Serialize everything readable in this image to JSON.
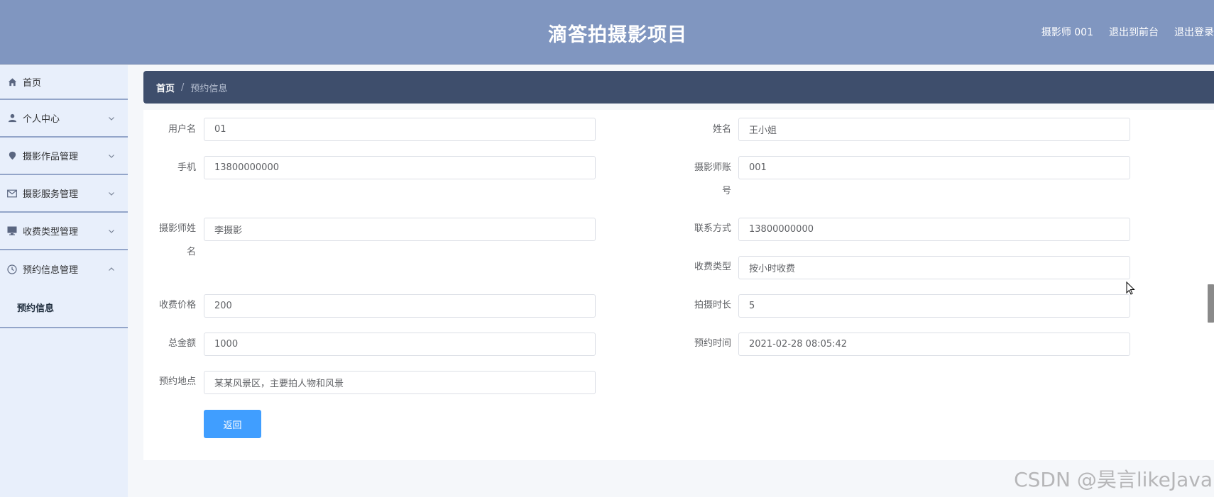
{
  "header": {
    "title": "滴答拍摄影项目",
    "user": "摄影师 001",
    "to_front": "退出到前台",
    "logout": "退出登录"
  },
  "sidebar": {
    "items": [
      {
        "label": "首页",
        "icon": "home-icon"
      },
      {
        "label": "个人中心",
        "icon": "user-icon"
      },
      {
        "label": "摄影作品管理",
        "icon": "location-icon"
      },
      {
        "label": "摄影服务管理",
        "icon": "mail-icon"
      },
      {
        "label": "收费类型管理",
        "icon": "monitor-icon"
      },
      {
        "label": "预约信息管理",
        "icon": "clock-icon"
      }
    ],
    "submenu": {
      "label": "预约信息"
    }
  },
  "breadcrumb": {
    "home": "首页",
    "separator": "/",
    "current": "预约信息"
  },
  "form": {
    "username": {
      "label": "用户名",
      "value": "01"
    },
    "name": {
      "label": "姓名",
      "value": "王小姐"
    },
    "phone": {
      "label": "手机",
      "value": "13800000000"
    },
    "photographer_account": {
      "label_line1": "摄影师账",
      "label_line2": "号",
      "value": "001"
    },
    "photographer_name": {
      "label_line1": "摄影师姓",
      "label_line2": "名",
      "value": "李摄影"
    },
    "contact": {
      "label": "联系方式",
      "value": "13800000000"
    },
    "fee_type": {
      "label": "收费类型",
      "value": "按小时收费"
    },
    "fee_price": {
      "label": "收费价格",
      "value": "200"
    },
    "duration": {
      "label": "拍摄时长",
      "value": "5"
    },
    "total": {
      "label": "总金额",
      "value": "1000"
    },
    "booking_time": {
      "label": "预约时间",
      "value": "2021-02-28 08:05:42"
    },
    "location": {
      "label": "预约地点",
      "value": "某某风景区，主要拍人物和风景"
    },
    "back_button": "返回"
  },
  "watermark": "CSDN @昊言likeJava",
  "colors": {
    "header_bg": "#8096c0",
    "sidebar_bg": "#e8effb",
    "breadcrumb_bg": "#3e4e6c",
    "primary": "#409eff"
  }
}
